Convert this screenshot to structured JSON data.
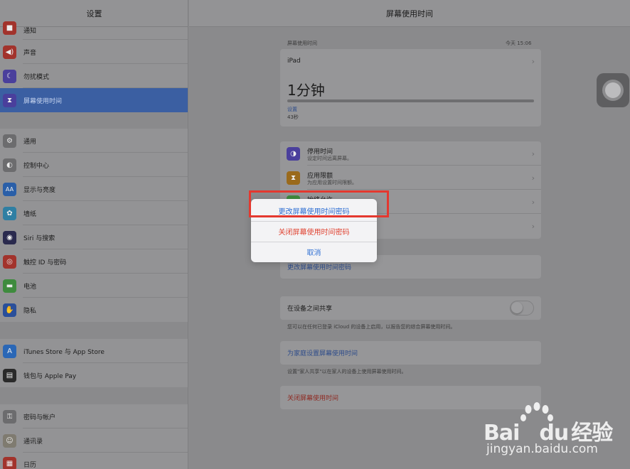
{
  "sidebar": {
    "title": "设置",
    "items": [
      {
        "label": "通知",
        "icon": "notifications-icon",
        "color": "#a2332c"
      },
      {
        "label": "声音",
        "icon": "sound-icon",
        "color": "#a2332c"
      },
      {
        "label": "勿扰模式",
        "icon": "moon-icon",
        "color": "#4a3f9c"
      },
      {
        "label": "屏幕使用时间",
        "icon": "hourglass-icon",
        "color": "#4a3f9c"
      },
      {
        "label": "通用",
        "icon": "gear-icon",
        "color": "#6c6c6e"
      },
      {
        "label": "控制中心",
        "icon": "control-center-icon",
        "color": "#6c6c6e"
      },
      {
        "label": "显示与亮度",
        "icon": "display-icon",
        "color": "#2a5fa8"
      },
      {
        "label": "墙纸",
        "icon": "wallpaper-icon",
        "color": "#2f7fa3"
      },
      {
        "label": "Siri 与搜索",
        "icon": "siri-icon",
        "color": "#2a2a4e"
      },
      {
        "label": "触控 ID 与密码",
        "icon": "fingerprint-icon",
        "color": "#a2332c"
      },
      {
        "label": "电池",
        "icon": "battery-icon",
        "color": "#3f8b3e"
      },
      {
        "label": "隐私",
        "icon": "hand-icon",
        "color": "#2a4f9a"
      },
      {
        "label": "iTunes Store 与 App Store",
        "icon": "app-store-icon",
        "color": "#2a67b6"
      },
      {
        "label": "钱包与 Apple Pay",
        "icon": "wallet-icon",
        "color": "#2a2a2a"
      },
      {
        "label": "密码与帐户",
        "icon": "key-icon",
        "color": "#6c6c6e"
      },
      {
        "label": "通讯录",
        "icon": "contacts-icon",
        "color": "#7f7b70"
      },
      {
        "label": "日历",
        "icon": "calendar-icon",
        "color": "#a2332c"
      }
    ]
  },
  "main": {
    "title": "屏幕使用时间",
    "usage": {
      "section_label": "屏幕使用时间",
      "timestamp": "今天 15:06",
      "device": "iPad",
      "total": "1分钟",
      "category": "设置",
      "category_time": "43秒",
      "fill_fraction": 1.0
    },
    "limits": [
      {
        "title": "停用时间",
        "subtitle": "设定时间远离屏幕。",
        "icon": "downtime-icon",
        "color": "#4a3f9c"
      },
      {
        "title": "应用限额",
        "subtitle": "为应用设置时间限额。",
        "icon": "hourglass-icon",
        "color": "#9a6a1c"
      },
      {
        "title": "始终允许",
        "subtitle": "",
        "icon": "check-icon",
        "color": "#3f8b3e"
      },
      {
        "title": "",
        "subtitle": "",
        "icon": "",
        "color": "#969698"
      }
    ],
    "change_passcode": "更改屏幕使用时间密码",
    "share_label": "在设备之间共享",
    "share_on": false,
    "share_footer": "您可以在任何已登录 iCloud 的设备上启用，以报告您的综合屏幕使用时间。",
    "family_link": "为家庭设置屏幕使用时间",
    "family_footer": "设置\"家人共享\"以在家人的设备上使用屏幕使用时间。",
    "turn_off": "关闭屏幕使用时间"
  },
  "action_sheet": {
    "change": "更改屏幕使用时间密码",
    "turn_off_passcode": "关闭屏幕使用时间密码",
    "cancel": "取消",
    "blue": "#2f6fd3",
    "red": "#e04433"
  },
  "watermark": {
    "logo_left": "Bai",
    "logo_mid": "du",
    "logo_right": "经验",
    "url": "jingyan.baidu.com"
  }
}
